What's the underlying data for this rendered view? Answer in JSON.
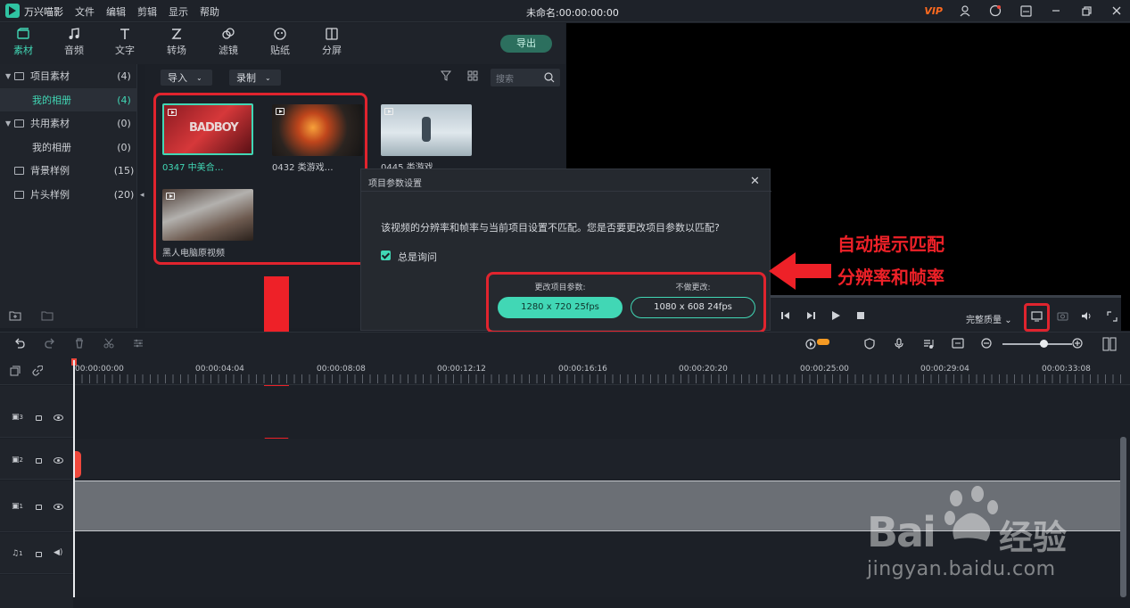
{
  "app": {
    "name": "万兴喵影",
    "document_title": "未命名:00:00:00:00",
    "vip_label": "VIP"
  },
  "menu": [
    "文件",
    "编辑",
    "剪辑",
    "显示",
    "帮助"
  ],
  "tabs": [
    {
      "label": "素材",
      "icon": "folder-icon"
    },
    {
      "label": "音频",
      "icon": "music-note-icon"
    },
    {
      "label": "文字",
      "icon": "text-icon"
    },
    {
      "label": "转场",
      "icon": "transition-icon"
    },
    {
      "label": "滤镜",
      "icon": "filter-icon"
    },
    {
      "label": "贴纸",
      "icon": "sticker-icon"
    },
    {
      "label": "分屏",
      "icon": "split-screen-icon"
    }
  ],
  "export_label": "导出",
  "library": [
    {
      "label": "项目素材",
      "count": "(4)"
    },
    {
      "label": "我的相册",
      "count": "(4)"
    },
    {
      "label": "共用素材",
      "count": "(0)"
    },
    {
      "label": "我的相册",
      "count": "(0)"
    },
    {
      "label": "背景样例",
      "count": "(15)"
    },
    {
      "label": "片头样例",
      "count": "(20)"
    }
  ],
  "media_toolbar": {
    "import": "导入",
    "record": "录制",
    "search_placeholder": "搜索"
  },
  "media_items": [
    {
      "caption": "0347 中美合…"
    },
    {
      "caption": "0432 类游戏…"
    },
    {
      "caption": "0445 类游戏…"
    },
    {
      "caption": "黑人电脑原视频"
    }
  ],
  "dialog": {
    "title": "项目参数设置",
    "message": "该视频的分辨率和帧率与当前项目设置不匹配。您是否要更改项目参数以匹配?",
    "checkbox_label": "总是询问",
    "option1_label": "更改项目参数:",
    "option1_button": "1280 x 720 25fps",
    "option2_label": "不做更改:",
    "option2_button": "1080 x 608 24fps"
  },
  "annotation": {
    "line1": "自动提示匹配",
    "line2": "分辨率和帧率"
  },
  "preview": {
    "quality_label": "完整质量"
  },
  "timeline": {
    "timecodes": [
      "00:00:00:00",
      "00:00:04:04",
      "00:00:08:08",
      "00:00:12:12",
      "00:00:16:16",
      "00:00:20:20",
      "00:00:25:00",
      "00:00:29:04",
      "00:00:33:08"
    ],
    "tracks": [
      {
        "label": "3",
        "type": "video"
      },
      {
        "label": "2",
        "type": "video"
      },
      {
        "label": "1",
        "type": "video"
      },
      {
        "label": "1",
        "type": "audio"
      }
    ]
  },
  "watermark": {
    "brand": "Bai",
    "brand_cn": "经验",
    "url": "jingyan.baidu.com"
  },
  "colors": {
    "accent": "#41d7b5",
    "annotation_red": "#ee2128",
    "background": "#1b1f26"
  }
}
